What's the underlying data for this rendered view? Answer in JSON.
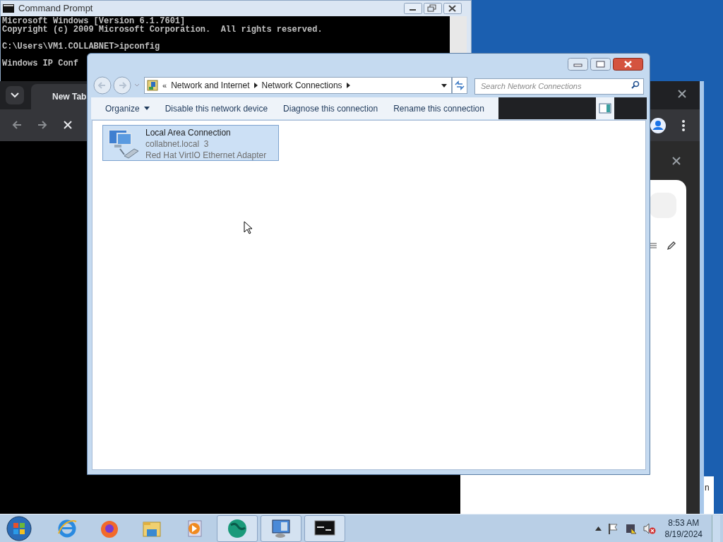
{
  "console_window": {
    "title": "Command Prompt",
    "paragraphs": [
      [
        "Microsoft Windows [Version 6.1.7601]",
        "Copyright (c) 2009 Microsoft Corporation.  All rights reserved."
      ],
      [
        "C:\\Users\\VM1.COLLABNET>ipconfig"
      ],
      [
        "Windows IP Conf"
      ]
    ]
  },
  "browser_window": {
    "tab": "New Tab",
    "side_text": "n"
  },
  "explorer_window": {
    "breadcrumb_overflow": "«",
    "breadcrumb": [
      "Network and Internet",
      "Network Connections"
    ],
    "search": {
      "placeholder": "Search Network Connections"
    },
    "toolbar": [
      {
        "label": "Organize",
        "kind": "menu"
      },
      {
        "label": "Disable this network device",
        "kind": "command"
      },
      {
        "label": "Diagnose this connection",
        "kind": "command"
      },
      {
        "label": "Rename this connection",
        "kind": "command"
      }
    ],
    "items": [
      {
        "name": "Local Area Connection",
        "network": "collabnet.local  3",
        "adapter": "Red Hat VirtIO Ethernet Adapter",
        "selected": true
      }
    ]
  },
  "taskbar": {
    "apps": [
      {
        "kind": "ie",
        "running": false
      },
      {
        "kind": "firefox",
        "running": false
      },
      {
        "kind": "folder",
        "running": false
      },
      {
        "kind": "media",
        "running": false
      },
      {
        "kind": "globe",
        "running": true
      },
      {
        "kind": "control",
        "running": true
      },
      {
        "kind": "console",
        "running": true
      }
    ],
    "time": "8:53 AM",
    "date": "8/19/2024"
  }
}
